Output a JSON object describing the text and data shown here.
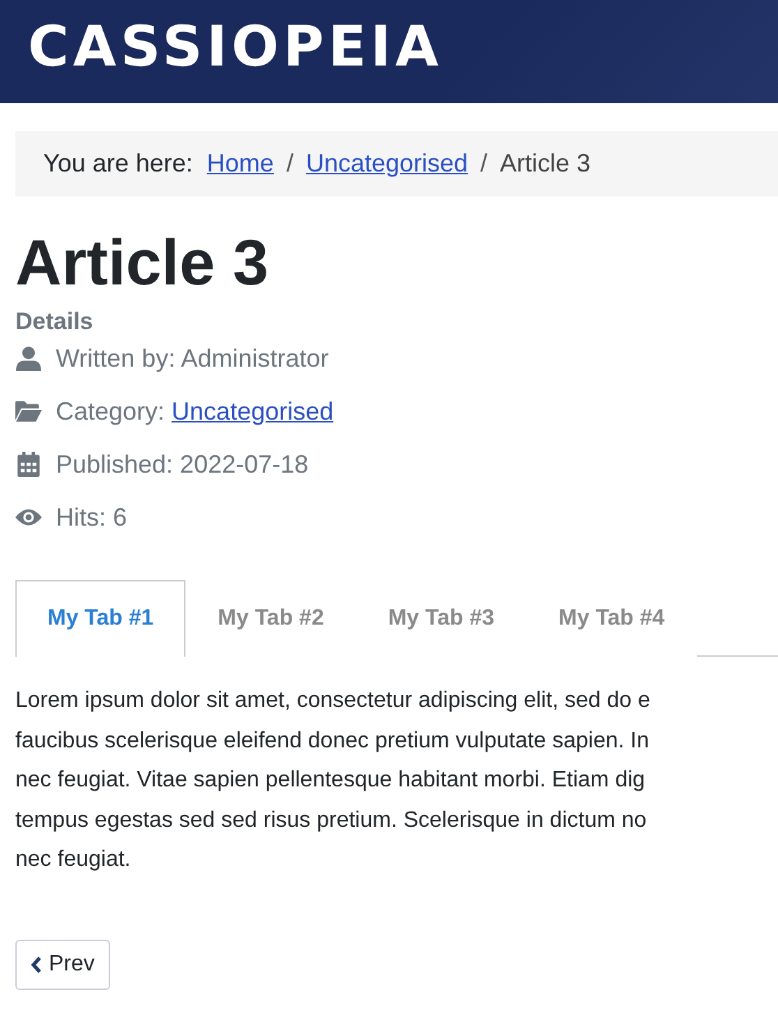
{
  "header": {
    "logo": "CASSIOPEIA"
  },
  "breadcrumb": {
    "label": "You are here:",
    "separator": "/",
    "items": [
      {
        "text": "Home",
        "kind": "link"
      },
      {
        "text": "Uncategorised",
        "kind": "link"
      },
      {
        "text": "Article 3",
        "kind": "current"
      }
    ]
  },
  "article": {
    "title": "Article 3",
    "details_heading": "Details",
    "details": [
      {
        "kind": "author",
        "label": "Written by: Administrator"
      },
      {
        "kind": "category",
        "label": "Category: ",
        "link": "Uncategorised"
      },
      {
        "kind": "published",
        "label": "Published: 2022-07-18"
      },
      {
        "kind": "hits",
        "label": "Hits: 6"
      }
    ]
  },
  "tabs": [
    {
      "label": "My Tab #1",
      "selected": true
    },
    {
      "label": "My Tab #2",
      "selected": false
    },
    {
      "label": "My Tab #3",
      "selected": false
    },
    {
      "label": "My Tab #4",
      "selected": false
    }
  ],
  "tab_content": [
    "Lorem ipsum dolor sit amet, consectetur adipiscing elit, sed do e",
    "faucibus scelerisque eleifend donec pretium vulputate sapien. In",
    "nec feugiat. Vitae sapien pellentesque habitant morbi. Etiam dig",
    "tempus egestas sed sed risus pretium. Scelerisque in dictum no",
    "nec feugiat."
  ],
  "pagination": {
    "prev": "Prev"
  }
}
